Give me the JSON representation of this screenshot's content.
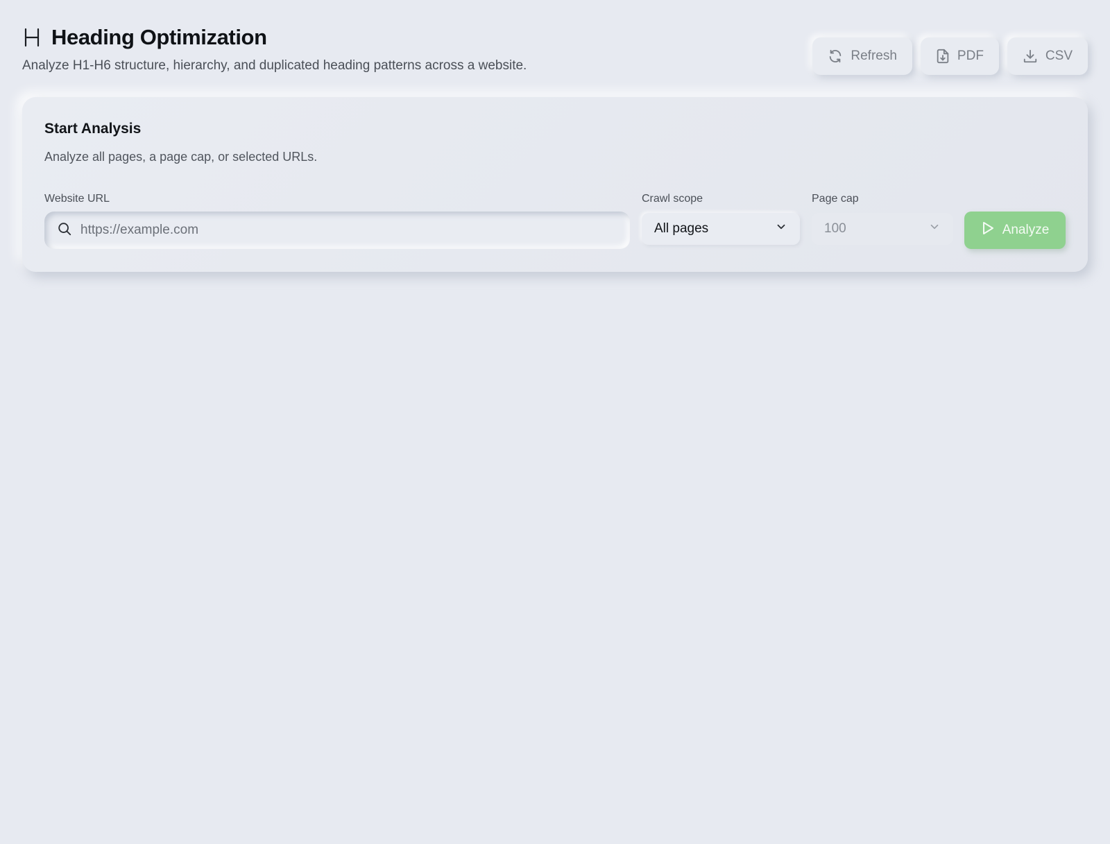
{
  "header": {
    "title": "Heading Optimization",
    "subtitle": "Analyze H1-H6 structure, hierarchy, and duplicated heading patterns across a website."
  },
  "toolbar": {
    "refresh_label": "Refresh",
    "pdf_label": "PDF",
    "csv_label": "CSV"
  },
  "card": {
    "title": "Start Analysis",
    "subtitle": "Analyze all pages, a page cap, or selected URLs.",
    "url_label": "Website URL",
    "url_placeholder": "https://example.com",
    "scope_label": "Crawl scope",
    "scope_value": "All pages",
    "cap_label": "Page cap",
    "cap_value": "100",
    "analyze_label": "Analyze"
  },
  "colors": {
    "background": "#e7eaf1",
    "accent_green": "#8fd18f",
    "text_primary": "#111418",
    "text_muted": "#7a7f87"
  },
  "icons": {
    "title": "heading-h-icon",
    "refresh": "refresh-icon",
    "pdf": "file-download-icon",
    "csv": "download-icon",
    "search": "search-icon",
    "dropdown": "chevron-down-icon",
    "analyze": "play-icon"
  }
}
